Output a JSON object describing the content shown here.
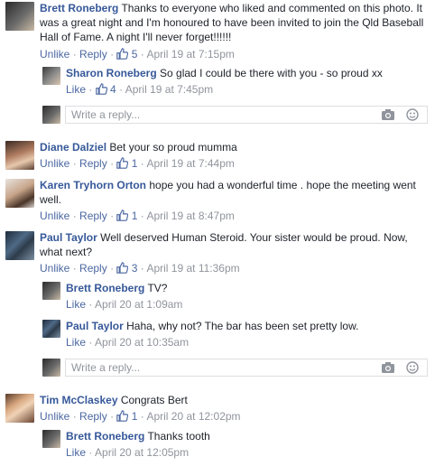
{
  "comments": [
    {
      "author": "Brett Roneberg",
      "text": "Thanks to everyone who liked and commented on this photo. It was a great night and I'm honoured to have been invited to join the Qld Baseball Hall of Fame. A night I'll never forget!!!!!!",
      "actions": {
        "unlike": "Unlike",
        "reply": "Reply",
        "likes": "5",
        "time": "April 19 at 7:15pm"
      },
      "replies": [
        {
          "author": "Sharon Roneberg",
          "text": "So glad I could be there with you - so proud xx",
          "actions": {
            "like": "Like",
            "likes": "4",
            "time": "April 19 at 7:45pm"
          }
        }
      ],
      "reply_placeholder": "Write a reply..."
    },
    {
      "author": "Diane Dalziel",
      "text": "Bet your so proud mumma",
      "actions": {
        "unlike": "Unlike",
        "reply": "Reply",
        "likes": "1",
        "time": "April 19 at 7:44pm"
      }
    },
    {
      "author": "Karen Tryhorn Orton",
      "text": "hope you had a wonderful time . hope the meeting went well.",
      "actions": {
        "unlike": "Unlike",
        "reply": "Reply",
        "likes": "1",
        "time": "April 19 at 8:47pm"
      }
    },
    {
      "author": "Paul Taylor",
      "text": "Well deserved Human Steroid. Your sister would be proud. Now, what next?",
      "actions": {
        "unlike": "Unlike",
        "reply": "Reply",
        "likes": "3",
        "time": "April 19 at 11:36pm"
      },
      "replies": [
        {
          "author": "Brett Roneberg",
          "text": "TV?",
          "actions": {
            "like": "Like",
            "time": "April 20 at 1:09am"
          }
        },
        {
          "author": "Paul Taylor",
          "text": "Haha, why not? The bar has been set pretty low.",
          "actions": {
            "like": "Like",
            "time": "April 20 at 10:35am"
          }
        }
      ],
      "reply_placeholder": "Write a reply..."
    },
    {
      "author": "Tim McClaskey",
      "text": "Congrats Bert",
      "actions": {
        "unlike": "Unlike",
        "reply": "Reply",
        "likes": "1",
        "time": "April 20 at 12:02pm"
      },
      "replies": [
        {
          "author": "Brett Roneberg",
          "text": "Thanks tooth",
          "actions": {
            "like": "Like",
            "time": "April 20 at 12:05pm"
          }
        }
      ]
    }
  ],
  "separator": "·",
  "icons": {
    "like": "thumbs-up-icon",
    "camera": "camera-icon",
    "emoji": "emoji-icon"
  },
  "colors": {
    "link": "#365899",
    "action": "#4b67a1",
    "meta": "#90949c",
    "border": "#dddfe2"
  }
}
